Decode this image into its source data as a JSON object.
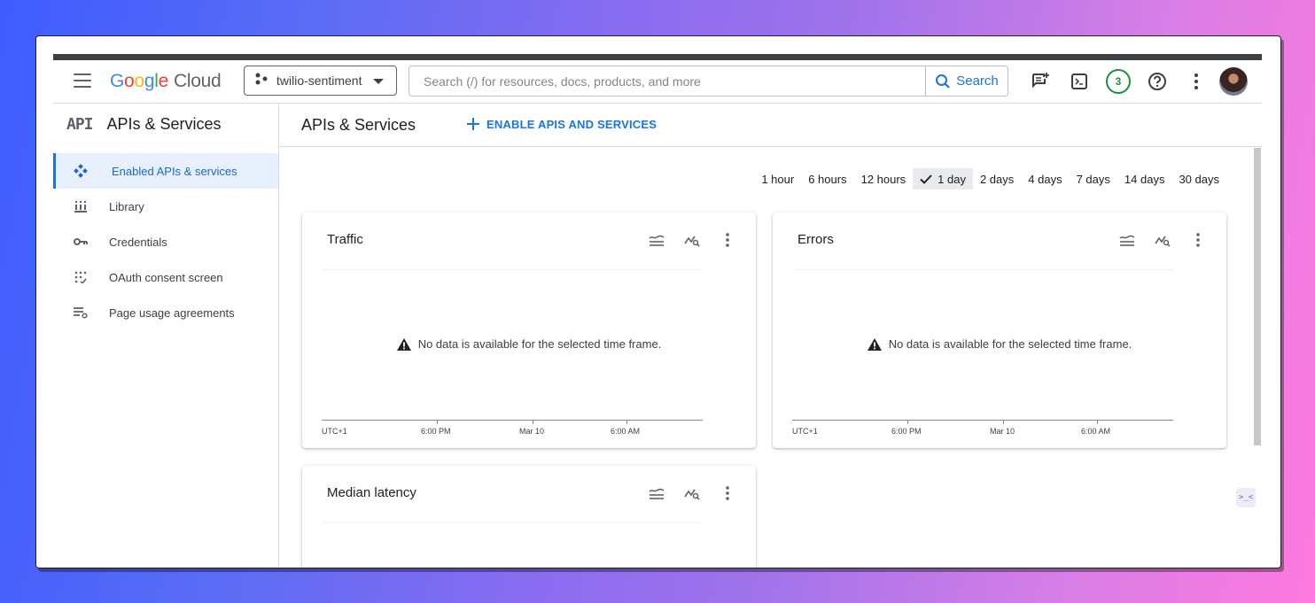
{
  "header": {
    "brand": {
      "g": "G",
      "o1": "o",
      "o2": "o",
      "g2": "g",
      "l": "l",
      "e": "e",
      "suffix": "Cloud"
    },
    "project_name": "twilio-sentiment",
    "search": {
      "placeholder": "Search (/) for resources, docs, products, and more",
      "button_label": "Search"
    },
    "notification_count": "3",
    "icons": [
      "menu-icon",
      "project-hierarchy-icon",
      "search-icon",
      "feedback-icon",
      "cloud-shell-icon",
      "help-icon",
      "more-vert-icon",
      "avatar"
    ]
  },
  "sidebar": {
    "glyph": "API",
    "title": "APIs & Services",
    "items": [
      {
        "label": "Enabled APIs & services",
        "icon": "diamond-arrows-icon",
        "active": true
      },
      {
        "label": "Library",
        "icon": "library-icon",
        "active": false
      },
      {
        "label": "Credentials",
        "icon": "key-icon",
        "active": false
      },
      {
        "label": "OAuth consent screen",
        "icon": "oauth-dots-icon",
        "active": false
      },
      {
        "label": "Page usage agreements",
        "icon": "list-settings-icon",
        "active": false
      }
    ]
  },
  "main": {
    "title": "APIs & Services",
    "enable_label": "ENABLE APIS AND SERVICES",
    "ranges": [
      "1 hour",
      "6 hours",
      "12 hours",
      "1 day",
      "2 days",
      "4 days",
      "7 days",
      "14 days",
      "30 days"
    ],
    "selected_range": "1 day",
    "no_data_message": "No data is available for the selected time frame.",
    "axis_labels": [
      "UTC+1",
      "6:00 PM",
      "Mar 10",
      "6:00 AM"
    ],
    "cards": [
      {
        "title": "Traffic"
      },
      {
        "title": "Errors"
      },
      {
        "title": "Median latency"
      }
    ]
  },
  "colors": {
    "accent": "#1a73e8",
    "badge": "#1e8e3e",
    "active_bg": "#e8f0fe"
  }
}
